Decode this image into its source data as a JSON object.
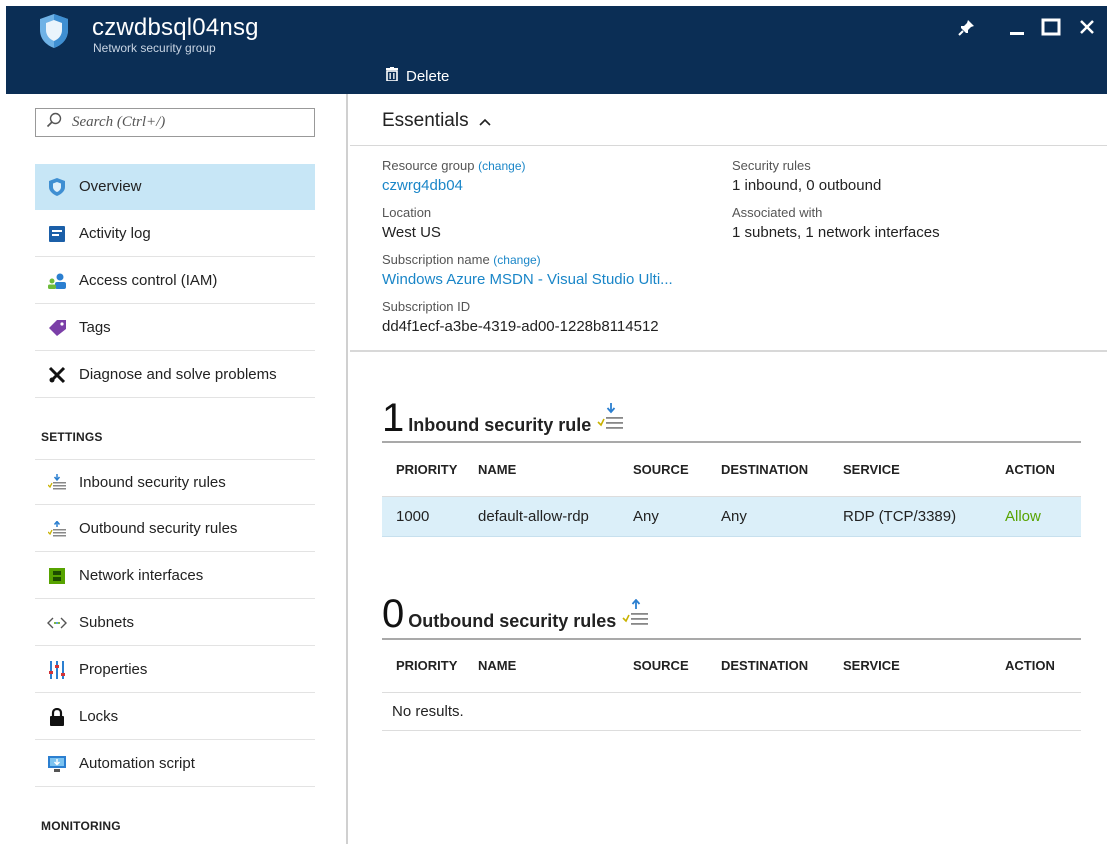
{
  "header": {
    "title": "czwdbsql04nsg",
    "subtitle": "Network security group",
    "delete_label": "Delete",
    "bg_color": "#0b2e55"
  },
  "sidebar": {
    "search_placeholder": "Search (Ctrl+/)",
    "items": [
      {
        "label": "Overview",
        "icon": "shield-icon",
        "active": true
      },
      {
        "label": "Activity log",
        "icon": "activity-log-icon"
      },
      {
        "label": "Access control (IAM)",
        "icon": "users-icon"
      },
      {
        "label": "Tags",
        "icon": "tag-icon"
      },
      {
        "label": "Diagnose and solve problems",
        "icon": "wrench-icon"
      }
    ],
    "settings_header": "SETTINGS",
    "settings_items": [
      {
        "label": "Inbound security rules",
        "icon": "inbound-rules-icon"
      },
      {
        "label": "Outbound security rules",
        "icon": "outbound-rules-icon"
      },
      {
        "label": "Network interfaces",
        "icon": "network-interface-icon"
      },
      {
        "label": "Subnets",
        "icon": "subnets-icon"
      },
      {
        "label": "Properties",
        "icon": "properties-icon"
      },
      {
        "label": "Locks",
        "icon": "lock-icon"
      },
      {
        "label": "Automation script",
        "icon": "automation-script-icon"
      }
    ],
    "monitoring_header": "MONITORING",
    "active_color": "#c7e6f6"
  },
  "essentials": {
    "title": "Essentials",
    "resource_group_label": "Resource group",
    "change_label": "(change)",
    "resource_group_value": "czwrg4db04",
    "location_label": "Location",
    "location_value": "West US",
    "subscription_name_label": "Subscription name",
    "subscription_name_value": "Windows Azure MSDN - Visual Studio Ulti...",
    "subscription_id_label": "Subscription ID",
    "subscription_id_value": "dd4f1ecf-a3be-4319-ad00-1228b8114512",
    "security_rules_label": "Security rules",
    "security_rules_value": "1 inbound, 0 outbound",
    "associated_label": "Associated with",
    "associated_value": "1 subnets, 1 network interfaces",
    "link_color": "#1a86c8"
  },
  "inbound": {
    "count": "1",
    "title": "Inbound security rule",
    "columns": [
      "PRIORITY",
      "NAME",
      "SOURCE",
      "DESTINATION",
      "SERVICE",
      "ACTION"
    ],
    "rows": [
      {
        "priority": "1000",
        "name": "default-allow-rdp",
        "source": "Any",
        "destination": "Any",
        "service": "RDP (TCP/3389)",
        "action": "Allow"
      }
    ]
  },
  "outbound": {
    "count": "0",
    "title": "Outbound security rules",
    "columns": [
      "PRIORITY",
      "NAME",
      "SOURCE",
      "DESTINATION",
      "SERVICE",
      "ACTION"
    ],
    "empty_text": "No results."
  },
  "colors": {
    "allow": "#57a300",
    "row_highlight": "#dbeff9"
  }
}
